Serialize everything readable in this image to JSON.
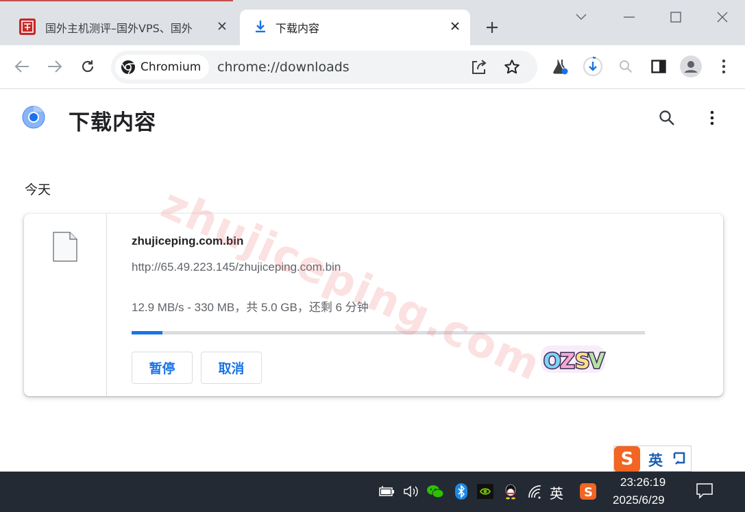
{
  "tabs": [
    {
      "title": "国外主机测评–国外VPS、国外",
      "active": false
    },
    {
      "title": "下载内容",
      "active": true
    }
  ],
  "toolbar": {
    "site_chip": "Chromium",
    "url": "chrome://downloads"
  },
  "page": {
    "title": "下载内容",
    "section_label": "今天"
  },
  "download": {
    "file_name": "zhujiceping.com.bin",
    "file_url": "http://65.49.223.145/zhujiceping.com.bin",
    "status": "12.9 MB/s - 330 MB，共 5.0 GB，还剩 6 分钟",
    "progress_fraction": 0.06,
    "pause_label": "暂停",
    "cancel_label": "取消"
  },
  "watermark": "zhujiceping.com",
  "sticker_text": "OZSV",
  "ime": {
    "logo": "S",
    "lang": "英"
  },
  "taskbar": {
    "ime_lang": "英",
    "time": "23:26:19",
    "date": "2025/6/29"
  },
  "colors": {
    "accent": "#1a73e8",
    "tabstrip": "#dee1e6",
    "taskbar": "#232a33"
  }
}
